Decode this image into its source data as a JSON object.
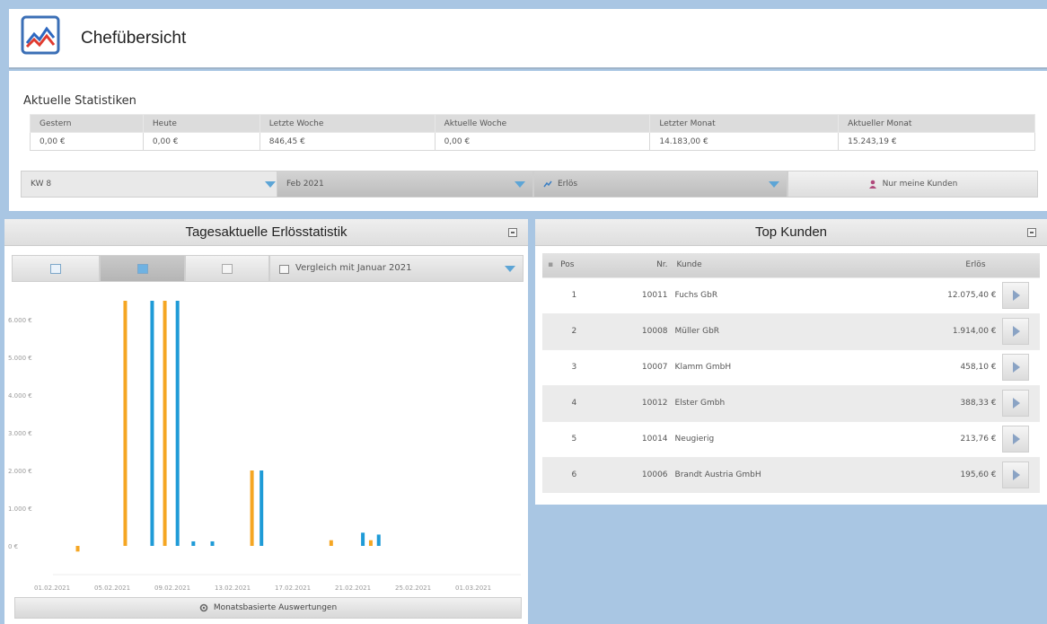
{
  "header": {
    "title": "Chefübersicht"
  },
  "stats": {
    "heading": "Aktuelle Statistiken",
    "columns": [
      "Gestern",
      "Heute",
      "Letzte Woche",
      "Aktuelle Woche",
      "Letzter Monat",
      "Aktueller Monat"
    ],
    "values": [
      "0,00 €",
      "0,00 €",
      "846,45 €",
      "0,00 €",
      "14.183,00 €",
      "15.243,19 €"
    ]
  },
  "filters": {
    "week": "KW 8",
    "month": "Feb 2021",
    "metric": "Erlös",
    "my_customers": "Nur meine Kunden"
  },
  "revenue_panel": {
    "title": "Tagesaktuelle Erlösstatistik",
    "compare_label": "Vergleich mit Januar 2021",
    "footer_button": "Monatsbasierte Auswertungen"
  },
  "chart_data": {
    "type": "bar",
    "y_ticks": [
      "6.000 €",
      "5.000 €",
      "4.000 €",
      "3.000 €",
      "2.000 €",
      "1.000 €",
      "0 €"
    ],
    "x_ticks": [
      "01.02.2021",
      "05.02.2021",
      "09.02.2021",
      "13.02.2021",
      "17.02.2021",
      "21.02.2021",
      "25.02.2021",
      "01.03.2021"
    ],
    "ylim": [
      0,
      6300
    ],
    "series": [
      {
        "color": "#f5a623",
        "values": [
          [
            0.2,
            -150
          ],
          [
            3.2,
            6500
          ],
          [
            5.7,
            6500
          ],
          [
            11.2,
            2000
          ],
          [
            16.2,
            150
          ],
          [
            18.7,
            150
          ]
        ]
      },
      {
        "color": "#1f9bd7",
        "values": [
          [
            4.9,
            6500
          ],
          [
            6.5,
            6500
          ],
          [
            7.5,
            120
          ],
          [
            8.7,
            120
          ],
          [
            11.8,
            2000
          ],
          [
            18.2,
            350
          ],
          [
            19.2,
            300
          ]
        ]
      }
    ]
  },
  "top_customers": {
    "title": "Top Kunden",
    "columns": {
      "pos": "Pos",
      "nr": "Nr.",
      "kunde": "Kunde",
      "erloes": "Erlös"
    },
    "rows": [
      {
        "pos": "1",
        "nr": "10011",
        "kunde": "Fuchs GbR",
        "erloes": "12.075,40 €"
      },
      {
        "pos": "2",
        "nr": "10008",
        "kunde": "Müller GbR",
        "erloes": "1.914,00 €"
      },
      {
        "pos": "3",
        "nr": "10007",
        "kunde": "Klamm GmbH",
        "erloes": "458,10 €"
      },
      {
        "pos": "4",
        "nr": "10012",
        "kunde": "Elster Gmbh",
        "erloes": "388,33 €"
      },
      {
        "pos": "5",
        "nr": "10014",
        "kunde": "Neugierig",
        "erloes": "213,76 €"
      },
      {
        "pos": "6",
        "nr": "10006",
        "kunde": "Brandt Austria GmbH",
        "erloes": "195,60 €"
      }
    ]
  }
}
